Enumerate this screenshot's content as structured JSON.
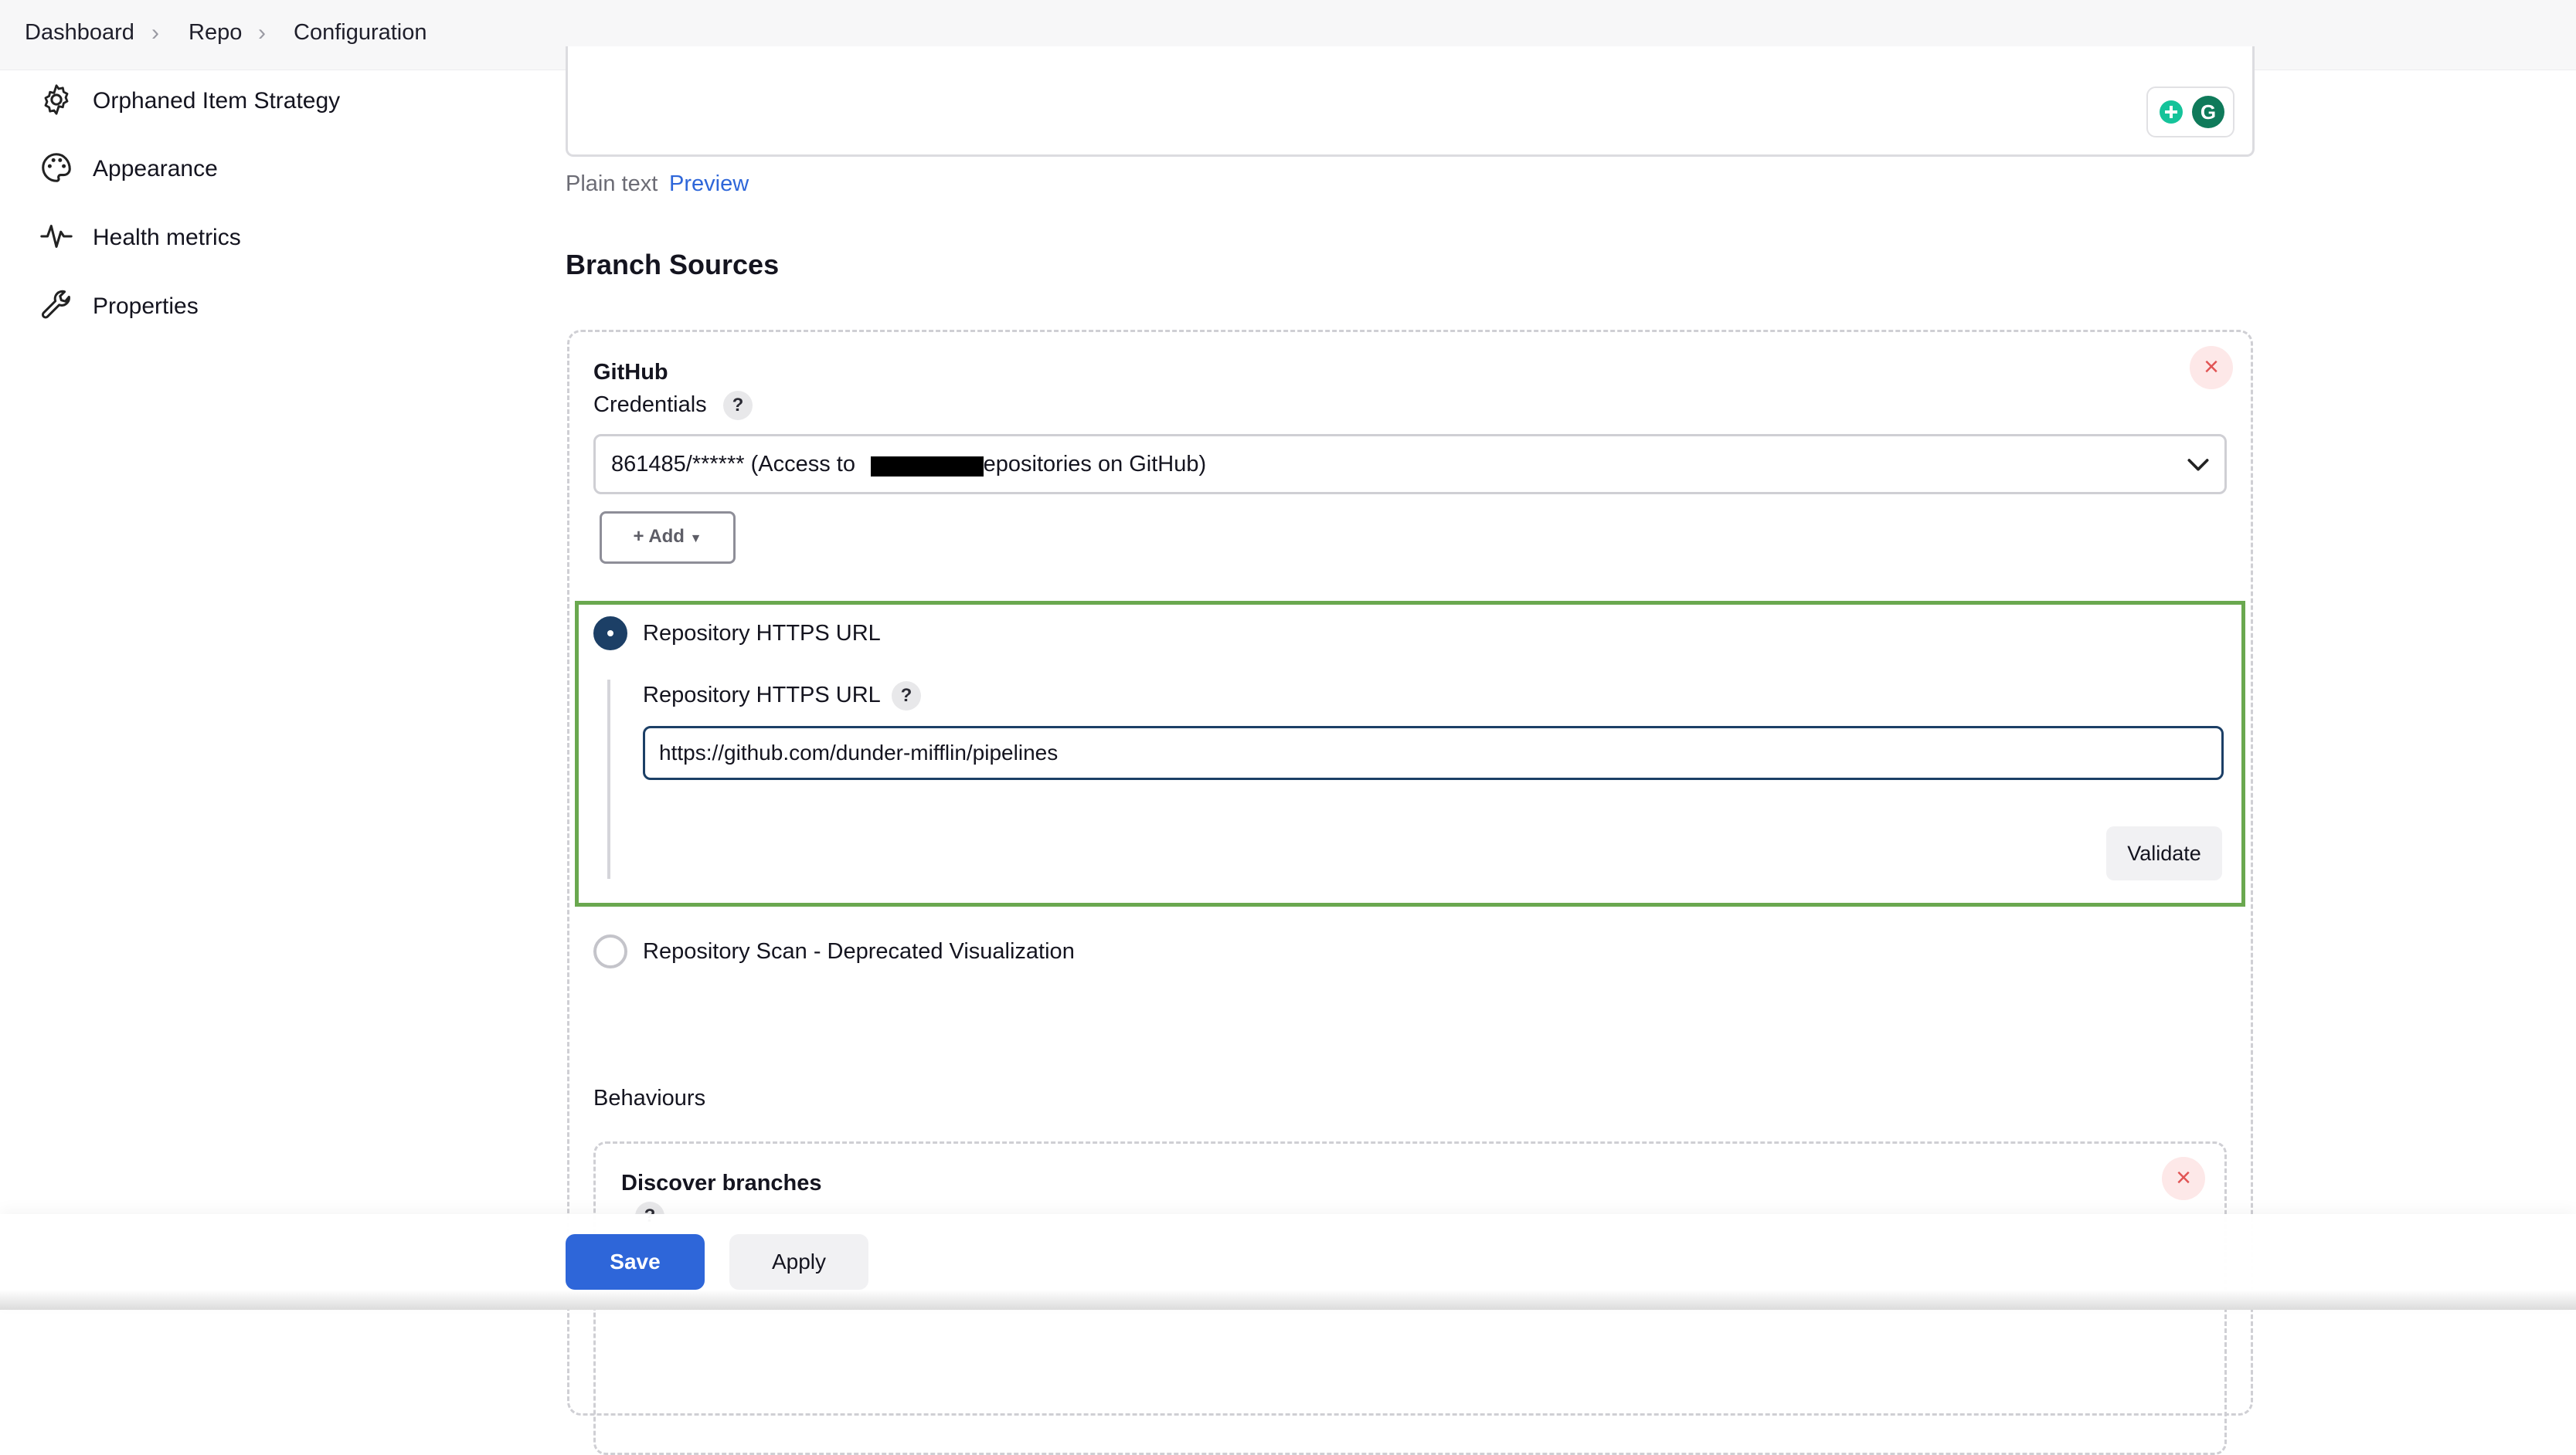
{
  "breadcrumb": {
    "items": [
      "Dashboard",
      "Repo",
      "Configuration"
    ]
  },
  "sidebar": {
    "items": [
      {
        "label": "Orphaned Item Strategy",
        "icon": "gear-icon"
      },
      {
        "label": "Appearance",
        "icon": "palette-icon"
      },
      {
        "label": "Health metrics",
        "icon": "pulse-icon"
      },
      {
        "label": "Properties",
        "icon": "wrench-icon"
      }
    ]
  },
  "description": {
    "plain_text_label": "Plain text",
    "preview_label": "Preview"
  },
  "branch_sources": {
    "title": "Branch Sources",
    "github": {
      "title": "GitHub",
      "credentials_label": "Credentials",
      "credentials_prefix": "861485/****** (Access to",
      "credentials_suffix": "repositories on GitHub)",
      "add_label": "Add",
      "options": [
        {
          "label": "Repository HTTPS URL",
          "selected": true
        },
        {
          "label": "Repository Scan - Deprecated Visualization",
          "selected": false
        }
      ],
      "https_url_label": "Repository HTTPS URL",
      "https_url_value": "https://github.com/dunder-mifflin/pipelines",
      "validate_label": "Validate",
      "behaviours_label": "Behaviours",
      "behaviour_title": "Discover branches"
    }
  },
  "footer": {
    "save_label": "Save",
    "apply_label": "Apply"
  },
  "colors": {
    "accent": "#2e66d9",
    "highlight_border": "#6aa84f",
    "radio_selected": "#1c3f66",
    "close_red": "#e15454"
  }
}
